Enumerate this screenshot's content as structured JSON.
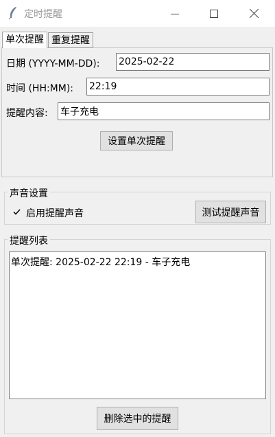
{
  "window": {
    "title": "定时提醒",
    "app_icon": "feather-icon"
  },
  "tabs": [
    {
      "label": "单次提醒",
      "active": true
    },
    {
      "label": "重复提醒",
      "active": false
    }
  ],
  "single": {
    "date_label": "日期 (YYYY-MM-DD):",
    "date_value": "2025-02-22",
    "time_label": "时间 (HH:MM):",
    "time_value": "22:19",
    "content_label": "提醒内容:",
    "content_value": "车子充电",
    "set_button": "设置单次提醒"
  },
  "sound": {
    "group_title": "声音设置",
    "enable_label": "启用提醒声音",
    "enabled": true,
    "test_button": "测试提醒声音"
  },
  "reminders": {
    "group_title": "提醒列表",
    "items": [
      "单次提醒: 2025-02-22 22:19 - 车子充电"
    ],
    "delete_button": "删除选中的提醒"
  }
}
